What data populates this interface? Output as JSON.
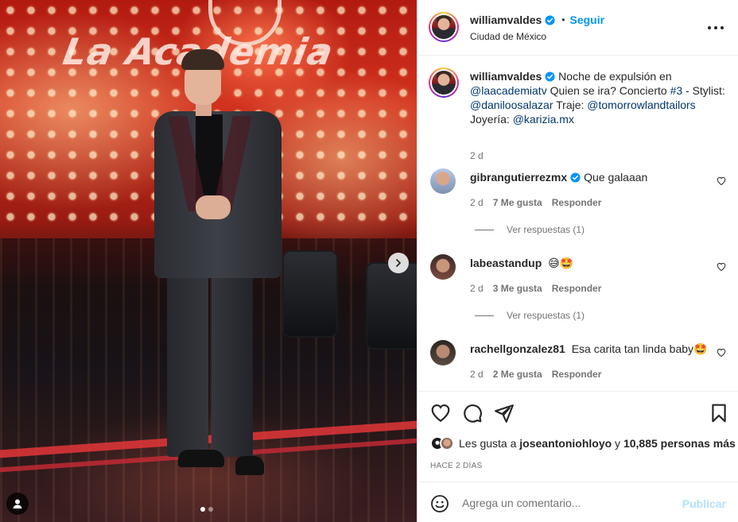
{
  "post": {
    "photo_alt": "",
    "carousel": {
      "count": 2,
      "active": 1
    }
  },
  "header": {
    "username": "williamvaldes",
    "separator": "•",
    "follow_label": "Seguir",
    "location": "Ciudad de México",
    "more_icon": "more-horizontal-icon"
  },
  "caption": {
    "username": "williamvaldes",
    "text_1": "Noche de expulsión en ",
    "mention_1": "@laacademiatv",
    "text_2": " Quien se ira? Concierto ",
    "hashtag_1": "#3",
    "text_3": " - Stylist: ",
    "mention_2": "@daniloosalazar",
    "text_4": " Traje: ",
    "mention_3": "@tomorrowlandtailors",
    "text_5": " Joyería: ",
    "mention_4": "@karizia.mx",
    "time": "2 d"
  },
  "comments": [
    {
      "username": "gibrangutierrezmx",
      "verified": true,
      "text": "Que galaaan",
      "time": "2 d",
      "likes": "7 Me gusta",
      "reply_label": "Responder",
      "view_replies": "Ver respuestas (1)"
    },
    {
      "username": "labeastandup",
      "verified": false,
      "text": "😅🤩",
      "time": "2 d",
      "likes": "3 Me gusta",
      "reply_label": "Responder",
      "view_replies": "Ver respuestas (1)"
    },
    {
      "username": "rachellgonzalez81",
      "verified": false,
      "text": "Esa carita tan linda baby🤩",
      "time": "2 d",
      "likes": "2 Me gusta",
      "reply_label": "Responder"
    }
  ],
  "actions": {
    "likes_prefix": "Les gusta a ",
    "likes_user": "joseantoniohloyo",
    "likes_mid": " y ",
    "likes_count": "10,885 personas más",
    "post_time": "HACE 2 DÍAS"
  },
  "add_comment": {
    "placeholder": "Agrega un comentario...",
    "publish_label": "Publicar"
  },
  "colors": {
    "link_blue": "#0095f6",
    "mention_blue": "#00376b",
    "muted": "#737373",
    "publish_disabled": "#b2dffc"
  }
}
